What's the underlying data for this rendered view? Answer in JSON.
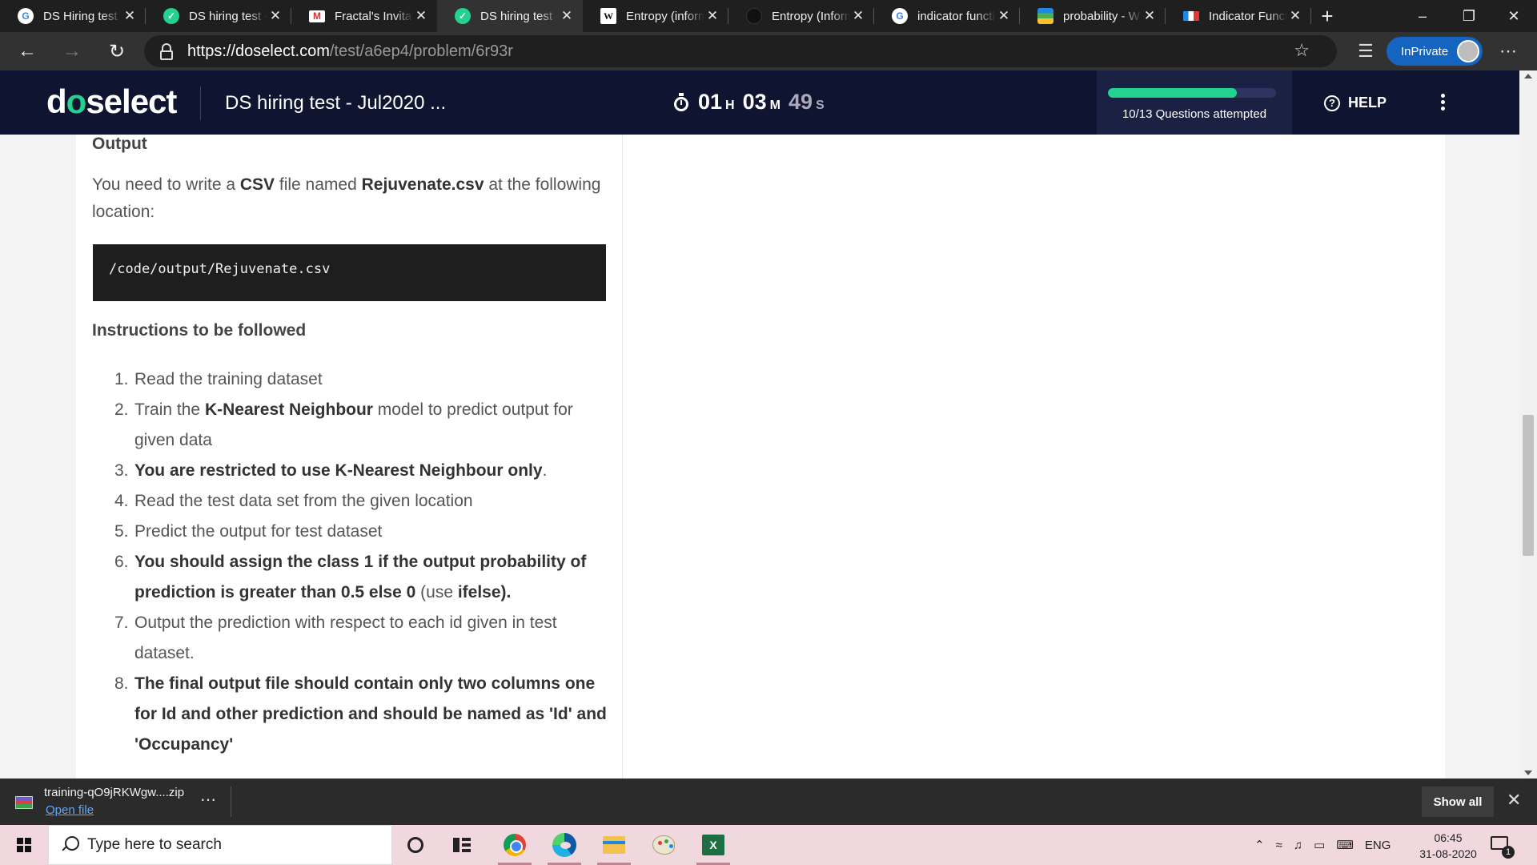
{
  "browser": {
    "tabs": [
      {
        "title": "DS Hiring test",
        "icon": "google-g-icon",
        "icon_color": "#ffffff",
        "active": false
      },
      {
        "title": "DS hiring test -",
        "icon": "check-circle-icon",
        "icon_color": "#24d28f",
        "active": false
      },
      {
        "title": "Fractal's Invitat",
        "icon": "gmail-icon",
        "icon_color": "#ffffff",
        "active": false
      },
      {
        "title": "DS hiring test -",
        "icon": "check-circle-icon",
        "icon_color": "#24d28f",
        "active": true
      },
      {
        "title": "Entropy (inform",
        "icon": "wikipedia-w-icon",
        "icon_color": "#ffffff",
        "active": false
      },
      {
        "title": "Entropy (Inform",
        "icon": "dark-globe-icon",
        "icon_color": "#111111",
        "active": false
      },
      {
        "title": "indicator functi",
        "icon": "google-g-icon",
        "icon_color": "#ffffff",
        "active": false
      },
      {
        "title": "probability - W",
        "icon": "stackexchange-icon",
        "icon_color": "#4caf50",
        "active": false
      },
      {
        "title": "Indicator Functi",
        "icon": "flag-icon",
        "icon_color": "#ffffff",
        "active": false
      }
    ],
    "url_host": "https://doselect.com",
    "url_path": "/test/a6ep4/problem/6r93r",
    "inprivate_label": "InPrivate"
  },
  "app": {
    "logo_parts": [
      "d",
      "o",
      "select"
    ],
    "test_title": "DS hiring test - Jul2020 ...",
    "timer": {
      "hours": "01",
      "hours_unit": "H",
      "minutes": "03",
      "minutes_unit": "M",
      "seconds": "49",
      "seconds_unit": "S"
    },
    "progress": {
      "label": "10/13 Questions attempted",
      "fraction": 0.769
    },
    "help_label": "HELP",
    "accent_color": "#24d28f",
    "header_color": "#0f1531"
  },
  "problem": {
    "output_heading": "Output",
    "output_para": {
      "pre": "You need to write a ",
      "b1": "CSV",
      "mid": " file named ",
      "b2": "Rejuvenate.csv",
      "post": " at the following location:"
    },
    "output_path": "/code/output/Rejuvenate.csv",
    "instructions_heading": "Instructions to be followed",
    "instructions": [
      {
        "num": "1.",
        "plain_pre": "Read the training dataset",
        "bold": "",
        "plain_post": ""
      },
      {
        "num": "2.",
        "plain_pre": "Train the ",
        "bold": "K-Nearest Neighbour",
        "plain_post": "  model to predict output for given data"
      },
      {
        "num": "3.",
        "plain_pre": "",
        "bold": "You are restricted to use K-Nearest Neighbour only",
        "plain_post": "."
      },
      {
        "num": "4.",
        "plain_pre": "Read the test data set from the given location",
        "bold": "",
        "plain_post": ""
      },
      {
        "num": "5.",
        "plain_pre": "Predict the output for test dataset",
        "bold": "",
        "plain_post": ""
      },
      {
        "num": "6.",
        "plain_pre": "",
        "bold": "You should assign the class 1 if the output probability of prediction is greater than 0.5 else 0",
        "plain_post": " (use ",
        "bold2": "ifelse).",
        "tail": ""
      },
      {
        "num": "7.",
        "plain_pre": "Output the prediction with respect to each id given in test dataset.",
        "bold": "",
        "plain_post": ""
      },
      {
        "num": "8.",
        "plain_pre": "",
        "bold": "The final output file should contain only two columns one for Id and other prediction and should be named as 'Id' and 'Occupancy'",
        "plain_post": ""
      }
    ]
  },
  "downloads": {
    "filename": "training-qO9jRKWgw....zip",
    "open_label": "Open file",
    "show_all_label": "Show all"
  },
  "taskbar": {
    "search_placeholder": "Type here to search",
    "language": "ENG",
    "time": "06:45",
    "date": "31-08-2020",
    "notification_count": "1"
  }
}
